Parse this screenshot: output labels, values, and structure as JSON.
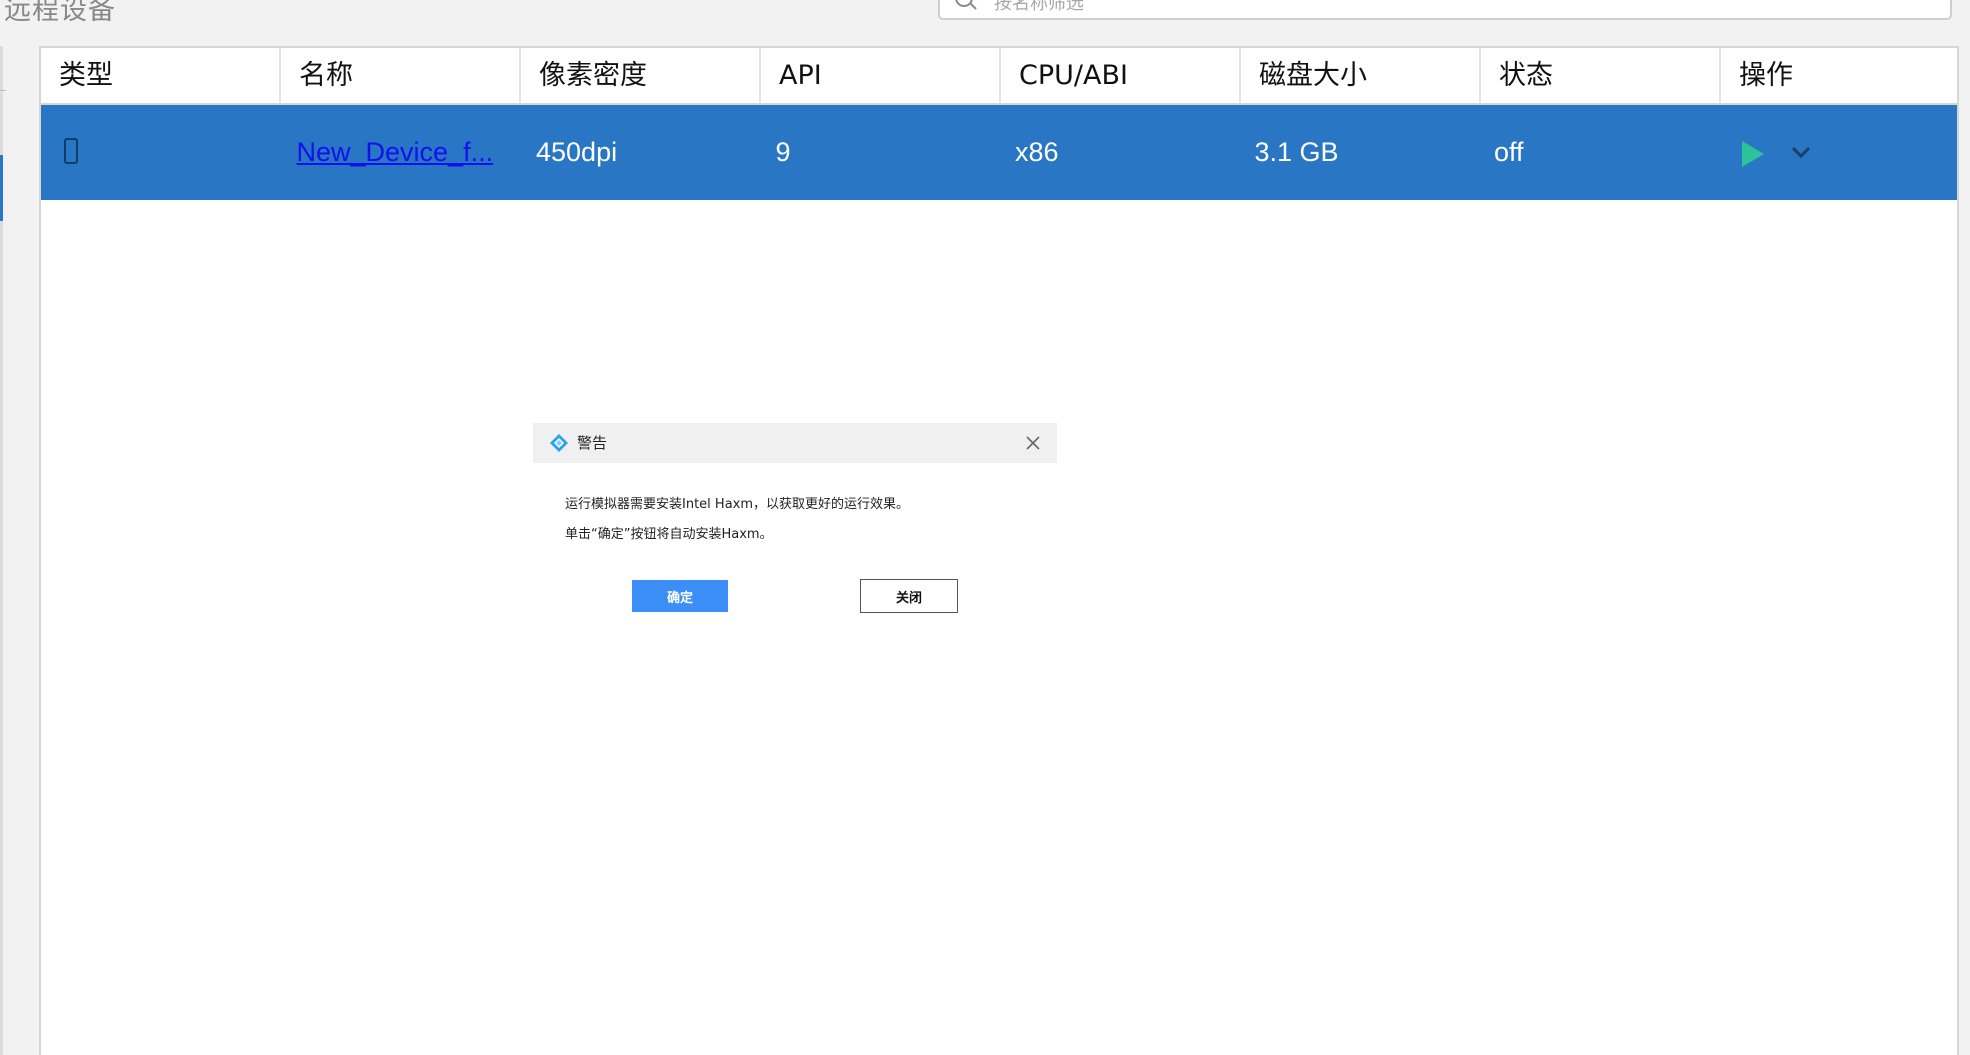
{
  "header": {
    "section_title": "远程设备",
    "search_placeholder": "按名称筛选"
  },
  "table": {
    "columns": [
      "类型",
      "名称",
      "像素密度",
      "API",
      "CPU/ABI",
      "磁盘大小",
      "状态",
      "操作"
    ],
    "rows": [
      {
        "type_icon": "phone-icon",
        "name": "New_Device_f...",
        "density": "450dpi",
        "api": "9",
        "cpu_abi": "x86",
        "disk_size": "3.1 GB",
        "status": "off",
        "actions": [
          "play-icon",
          "chevron-down-icon"
        ]
      }
    ],
    "selected_row_color": "#2876c4"
  },
  "dialog": {
    "title": "警告",
    "message_line1": "运行模拟器需要安装Intel Haxm，以获取更好的运行效果。",
    "message_line2": "单击“确定”按钮将自动安装Haxm。",
    "ok_label": "确定",
    "close_label": "关闭",
    "close_icon": "close-icon",
    "logo_icon": "app-logo-icon",
    "accent_color": "#3a8ef5"
  }
}
